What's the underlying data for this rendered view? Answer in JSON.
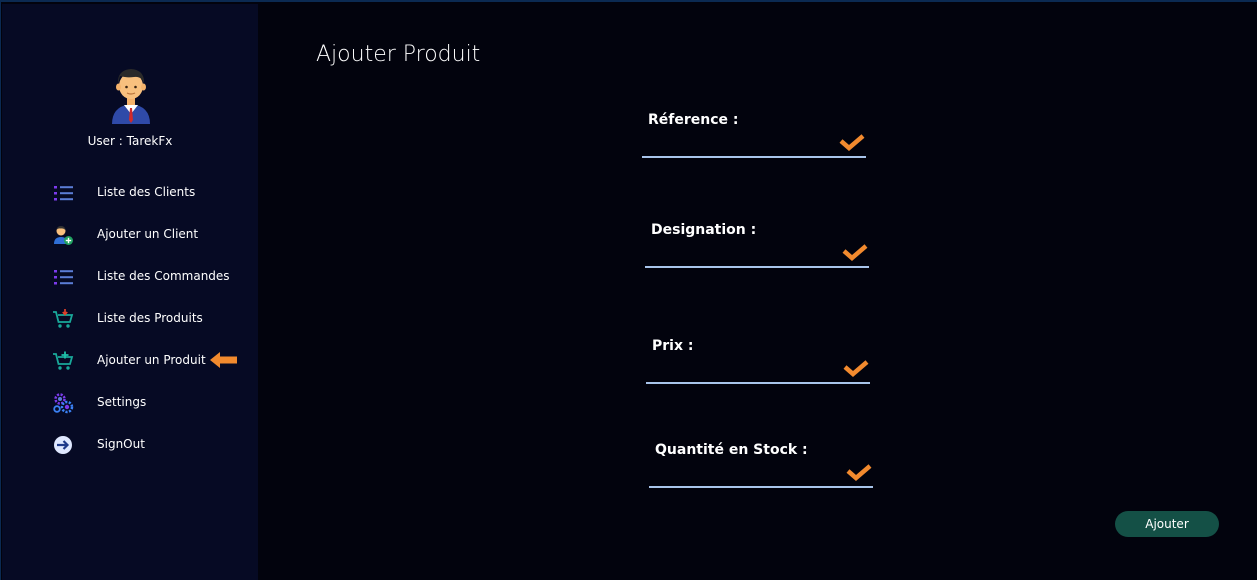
{
  "user": {
    "label": "User : TarekFx"
  },
  "sidebar": {
    "items": [
      {
        "label": "Liste des Clients",
        "icon": "list-icon"
      },
      {
        "label": "Ajouter un Client",
        "icon": "add-user-icon"
      },
      {
        "label": "Liste des Commandes",
        "icon": "list-icon"
      },
      {
        "label": "Liste des Produits",
        "icon": "cart-icon"
      },
      {
        "label": "Ajouter un Produit",
        "icon": "cart-add-icon",
        "active": true
      },
      {
        "label": "Settings",
        "icon": "gears-icon"
      },
      {
        "label": "SignOut",
        "icon": "signout-icon"
      }
    ]
  },
  "main": {
    "title": "Ajouter Produit",
    "fields": [
      {
        "label": "Réference :",
        "value": ""
      },
      {
        "label": "Designation :",
        "value": ""
      },
      {
        "label": "Prix :",
        "value": ""
      },
      {
        "label": "Quantité en Stock :",
        "value": ""
      }
    ],
    "submit_label": "Ajouter"
  },
  "colors": {
    "sidebar_bg": "#060a24",
    "main_bg": "#02030d",
    "accent_orange": "#f28a2e",
    "button_bg": "#145046",
    "underline": "#a8c4ea"
  }
}
